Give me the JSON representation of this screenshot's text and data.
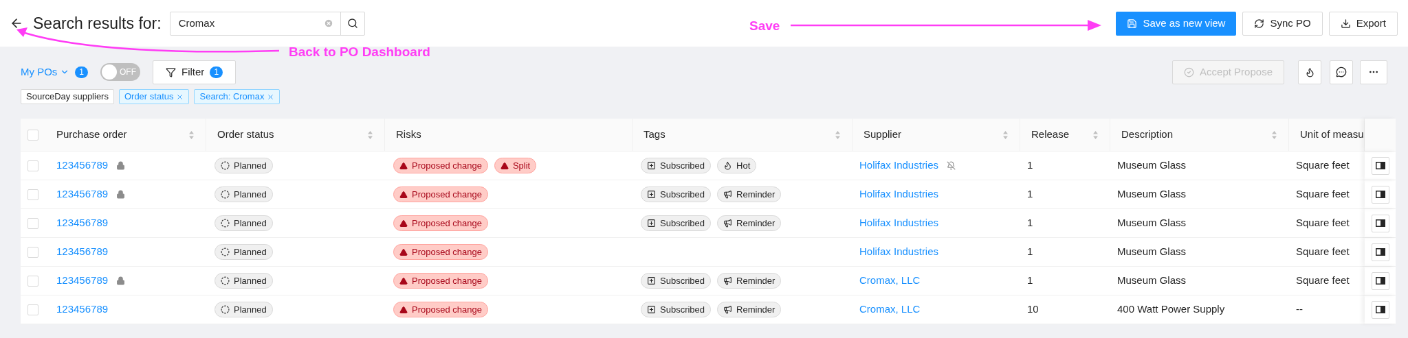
{
  "header": {
    "title": "Search results for:",
    "search": {
      "value": "Cromax"
    },
    "buttons": [
      {
        "kind": "save",
        "label": "Save as new view"
      },
      {
        "kind": "sync",
        "label": "Sync PO"
      },
      {
        "kind": "export",
        "label": "Export"
      }
    ]
  },
  "annotations": [
    {
      "kind": "back",
      "label": "Back to PO Dashboard"
    },
    {
      "kind": "save",
      "label": "Save"
    }
  ],
  "toolbar": {
    "view": {
      "label": "My POs",
      "count": "1"
    },
    "toggle": {
      "on": false,
      "label": "OFF"
    },
    "filter": {
      "label": "Filter",
      "count": "1"
    },
    "accept": {
      "label": "Accept Propose",
      "disabled": true
    }
  },
  "chips": [
    {
      "label": "SourceDay suppliers",
      "removable": false
    },
    {
      "label": "Order status",
      "removable": true
    },
    {
      "label": "Search: Cromax",
      "removable": true
    }
  ],
  "table": {
    "all_checked": false,
    "columns": [
      {
        "label": "Purchase order",
        "sortable": true
      },
      {
        "label": "Order status",
        "sortable": true
      },
      {
        "label": "Risks",
        "sortable": false
      },
      {
        "label": "Tags",
        "sortable": true
      },
      {
        "label": "Supplier",
        "sortable": true
      },
      {
        "label": "Release",
        "sortable": true
      },
      {
        "label": "Description",
        "sortable": true
      },
      {
        "label": "Unit of measu"
      }
    ],
    "rows": [
      {
        "checked": false,
        "po": "123456789",
        "locked": true,
        "status": "Planned",
        "risks": [
          "Proposed change",
          "Split"
        ],
        "tags": [
          {
            "kind": "subscribed",
            "label": "Subscribed"
          },
          {
            "kind": "hot",
            "label": "Hot"
          }
        ],
        "supplier": "Holifax Industries",
        "muted": true,
        "release": "1",
        "description": "Museum Glass",
        "unit": "Square feet"
      },
      {
        "checked": false,
        "po": "123456789",
        "locked": true,
        "status": "Planned",
        "risks": [
          "Proposed change"
        ],
        "tags": [
          {
            "kind": "subscribed",
            "label": "Subscribed"
          },
          {
            "kind": "reminder",
            "label": "Reminder"
          }
        ],
        "supplier": "Holifax Industries",
        "muted": false,
        "release": "1",
        "description": "Museum Glass",
        "unit": "Square feet"
      },
      {
        "checked": false,
        "po": "123456789",
        "locked": false,
        "status": "Planned",
        "risks": [
          "Proposed change"
        ],
        "tags": [
          {
            "kind": "subscribed",
            "label": "Subscribed"
          },
          {
            "kind": "reminder",
            "label": "Reminder"
          }
        ],
        "supplier": "Holifax Industries",
        "muted": false,
        "release": "1",
        "description": "Museum Glass",
        "unit": "Square feet"
      },
      {
        "checked": false,
        "po": "123456789",
        "locked": false,
        "status": "Planned",
        "risks": [
          "Proposed change"
        ],
        "tags": [],
        "supplier": "Holifax Industries",
        "muted": false,
        "release": "1",
        "description": "Museum Glass",
        "unit": "Square feet"
      },
      {
        "checked": false,
        "po": "123456789",
        "locked": true,
        "status": "Planned",
        "risks": [
          "Proposed change"
        ],
        "tags": [
          {
            "kind": "subscribed",
            "label": "Subscribed"
          },
          {
            "kind": "reminder",
            "label": "Reminder"
          }
        ],
        "supplier": "Cromax, LLC",
        "muted": false,
        "release": "1",
        "description": "Museum Glass",
        "unit": "Square feet"
      },
      {
        "checked": false,
        "po": "123456789",
        "locked": false,
        "status": "Planned",
        "risks": [
          "Proposed change"
        ],
        "tags": [
          {
            "kind": "subscribed",
            "label": "Subscribed"
          },
          {
            "kind": "reminder",
            "label": "Reminder"
          }
        ],
        "supplier": "Cromax, LLC",
        "muted": false,
        "release": "10",
        "description": "400 Watt Power Supply",
        "unit": "--"
      }
    ]
  }
}
